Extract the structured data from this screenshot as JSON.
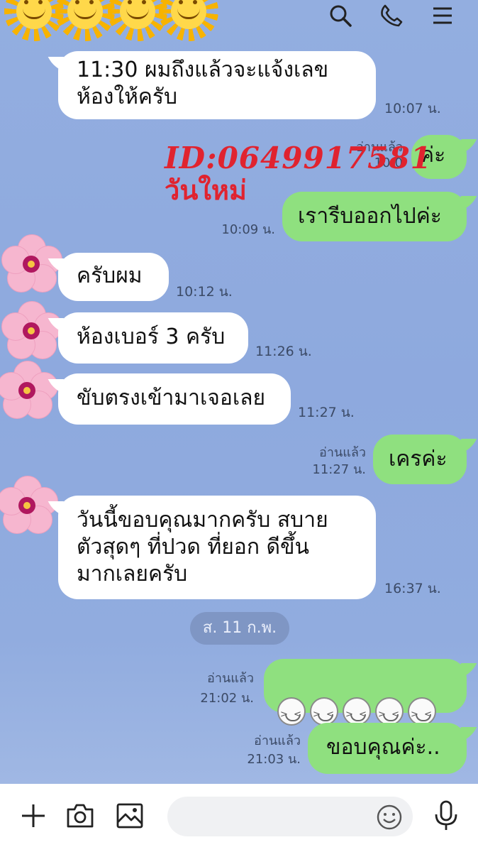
{
  "overlay": {
    "line1": "ID:0649917581",
    "line2": "วันใหม่"
  },
  "messages": [
    {
      "text": "11:30 ผมถึงแล้วจะแจ้งเลข\nห้องให้ครับ",
      "time": "10:07 น."
    },
    {
      "text": "ค่ะ",
      "read": "อ่านแล้ว",
      "time": "10:0"
    },
    {
      "text": "เรารีบออกไปค่ะ",
      "time": "10:09 น."
    },
    {
      "text": "ครับผม",
      "time": "10:12 น."
    },
    {
      "text": "ห้องเบอร์ 3 ครับ",
      "time": "11:26 น."
    },
    {
      "text": "ขับตรงเข้ามาเจอเลย",
      "time": "11:27 น."
    },
    {
      "text": "เครค่ะ",
      "read": "อ่านแล้ว",
      "time": "11:27 น."
    },
    {
      "text": "วันนี้ขอบคุณมากครับ สบาย\nตัวสุดๆ ที่ปวด ที่ยอก ดีขึ้น\nมากเลยครับ",
      "time": "16:37 น."
    },
    {
      "read": "อ่านแล้ว",
      "time": "21:02 น."
    },
    {
      "text": "ขอบคุณค่ะ..",
      "read": "อ่านแล้ว",
      "time": "21:03 น."
    }
  ],
  "date_separator": "ส. 11 ก.พ.",
  "icons": {
    "header": [
      "search-icon",
      "phone-icon",
      "menu-icon"
    ],
    "input": [
      "plus-icon",
      "camera-icon",
      "image-icon",
      "emoji-icon",
      "microphone-icon"
    ]
  },
  "colors": {
    "incoming": "#ffffff",
    "outgoing": "#8fe07f",
    "overlay": "#e0232f",
    "background": "#93aee0"
  }
}
